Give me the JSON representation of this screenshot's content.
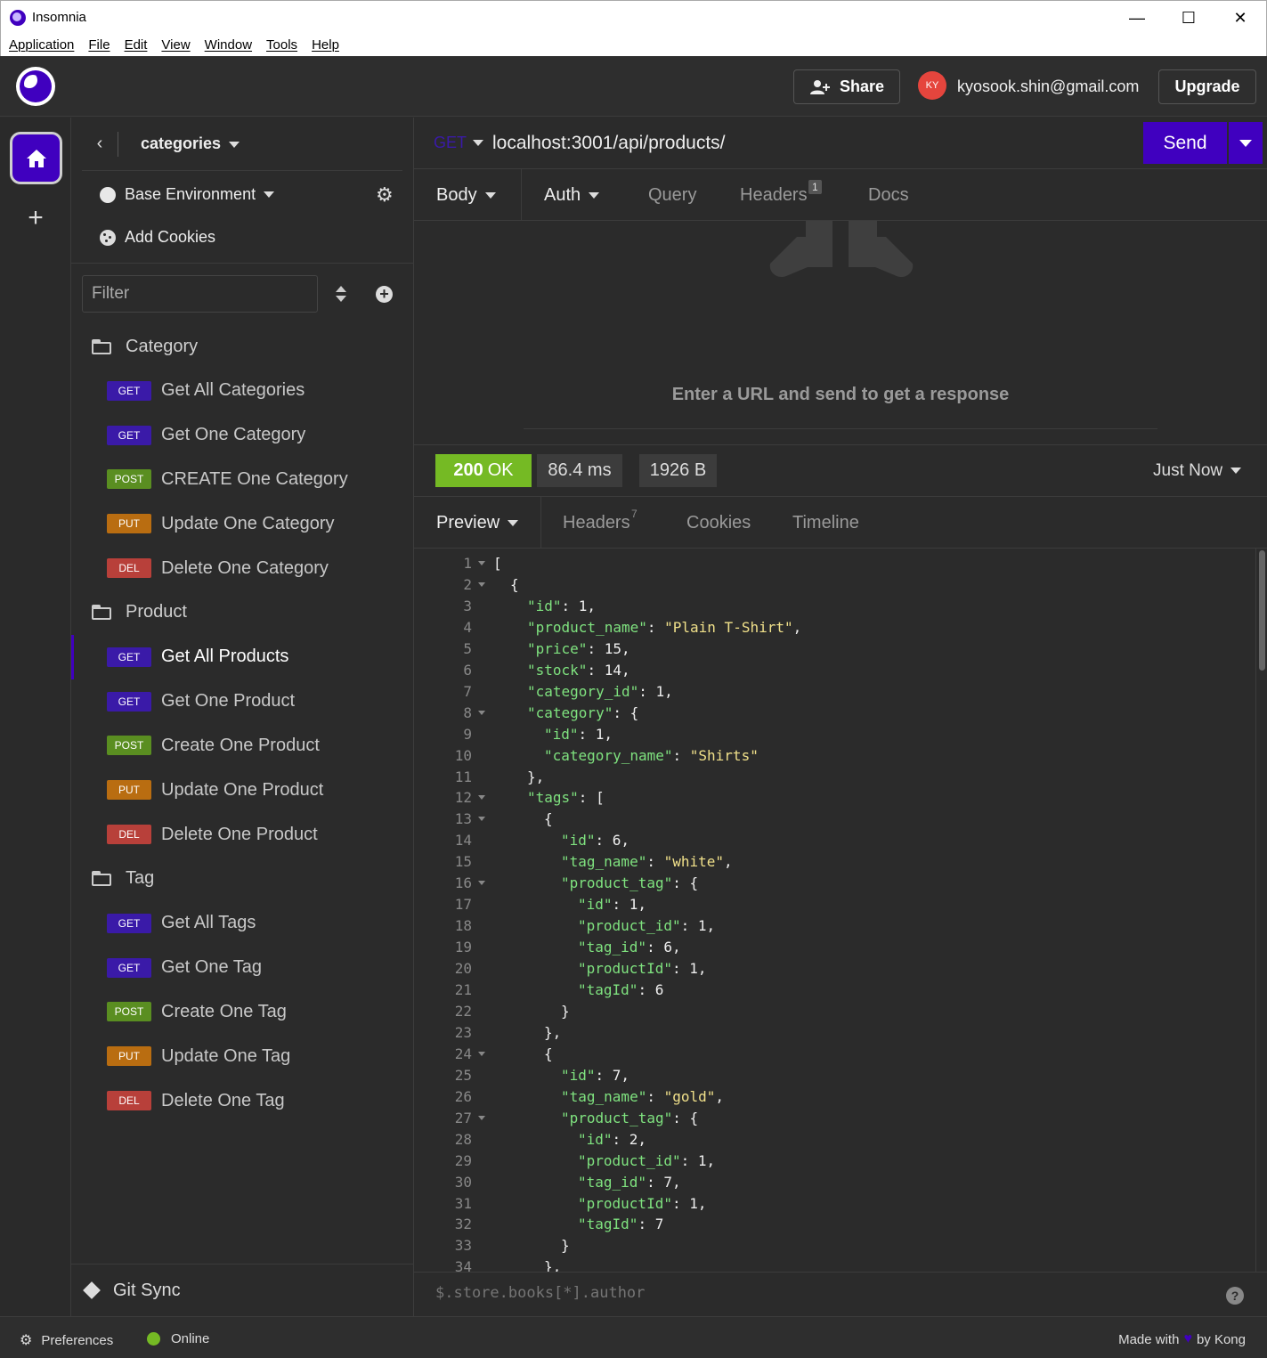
{
  "window": {
    "title": "Insomnia",
    "controls": {
      "minimize": "—",
      "maximize": "☐",
      "close": "✕"
    }
  },
  "menu": [
    "Application",
    "File",
    "Edit",
    "View",
    "Window",
    "Tools",
    "Help"
  ],
  "header": {
    "share_label": "Share",
    "avatar_initials": "KY",
    "user_email": "kyosook.shin@gmail.com",
    "upgrade_label": "Upgrade"
  },
  "sidebar": {
    "workspace": "categories",
    "environment": "Base Environment",
    "cookies_label": "Add Cookies",
    "filter_placeholder": "Filter",
    "groups": [
      {
        "name": "Category",
        "items": [
          {
            "method": "GET",
            "label": "Get All Categories"
          },
          {
            "method": "GET",
            "label": "Get One Category"
          },
          {
            "method": "POST",
            "label": "CREATE One Category"
          },
          {
            "method": "PUT",
            "label": "Update One Category"
          },
          {
            "method": "DEL",
            "label": "Delete One Category"
          }
        ]
      },
      {
        "name": "Product",
        "items": [
          {
            "method": "GET",
            "label": "Get All Products",
            "active": true
          },
          {
            "method": "GET",
            "label": "Get One Product"
          },
          {
            "method": "POST",
            "label": "Create One Product"
          },
          {
            "method": "PUT",
            "label": "Update One Product"
          },
          {
            "method": "DEL",
            "label": "Delete One Product"
          }
        ]
      },
      {
        "name": "Tag",
        "items": [
          {
            "method": "GET",
            "label": "Get All Tags"
          },
          {
            "method": "GET",
            "label": "Get One Tag"
          },
          {
            "method": "POST",
            "label": "Create One Tag"
          },
          {
            "method": "PUT",
            "label": "Update One Tag"
          },
          {
            "method": "DEL",
            "label": "Delete One Tag"
          }
        ]
      }
    ],
    "git_sync_label": "Git Sync"
  },
  "request": {
    "method": "GET",
    "url": "localhost:3001/api/products/",
    "send_label": "Send",
    "tabs": {
      "body": "Body",
      "auth": "Auth",
      "query": "Query",
      "headers": "Headers",
      "headers_count": "1",
      "docs": "Docs"
    },
    "empty_message": "Enter a URL and send to get a response"
  },
  "response": {
    "status_code": "200",
    "status_text": "OK",
    "time": "86.4 ms",
    "size": "1926 B",
    "when": "Just Now",
    "tabs": {
      "preview": "Preview",
      "headers": "Headers",
      "headers_count": "7",
      "cookies": "Cookies",
      "timeline": "Timeline"
    },
    "filter_placeholder": "$.store.books[*].author"
  },
  "code_lines": [
    {
      "n": "1",
      "fold": true,
      "indent": 0,
      "text": "["
    },
    {
      "n": "2",
      "fold": true,
      "indent": 1,
      "text": "{"
    },
    {
      "n": "3",
      "indent": 2,
      "key": "\"id\"",
      "rest": ": 1,"
    },
    {
      "n": "4",
      "indent": 2,
      "key": "\"product_name\"",
      "rest": ": ",
      "str": "\"Plain T-Shirt\"",
      "tail": ","
    },
    {
      "n": "5",
      "indent": 2,
      "key": "\"price\"",
      "rest": ": 15,"
    },
    {
      "n": "6",
      "indent": 2,
      "key": "\"stock\"",
      "rest": ": 14,"
    },
    {
      "n": "7",
      "indent": 2,
      "key": "\"category_id\"",
      "rest": ": 1,"
    },
    {
      "n": "8",
      "fold": true,
      "indent": 2,
      "key": "\"category\"",
      "rest": ": {"
    },
    {
      "n": "9",
      "indent": 3,
      "key": "\"id\"",
      "rest": ": 1,"
    },
    {
      "n": "10",
      "indent": 3,
      "key": "\"category_name\"",
      "rest": ": ",
      "str": "\"Shirts\"",
      "tail": ""
    },
    {
      "n": "11",
      "indent": 2,
      "text": "},"
    },
    {
      "n": "12",
      "fold": true,
      "indent": 2,
      "key": "\"tags\"",
      "rest": ": ["
    },
    {
      "n": "13",
      "fold": true,
      "indent": 3,
      "text": "{"
    },
    {
      "n": "14",
      "indent": 4,
      "key": "\"id\"",
      "rest": ": 6,"
    },
    {
      "n": "15",
      "indent": 4,
      "key": "\"tag_name\"",
      "rest": ": ",
      "str": "\"white\"",
      "tail": ","
    },
    {
      "n": "16",
      "fold": true,
      "indent": 4,
      "key": "\"product_tag\"",
      "rest": ": {"
    },
    {
      "n": "17",
      "indent": 5,
      "key": "\"id\"",
      "rest": ": 1,"
    },
    {
      "n": "18",
      "indent": 5,
      "key": "\"product_id\"",
      "rest": ": 1,"
    },
    {
      "n": "19",
      "indent": 5,
      "key": "\"tag_id\"",
      "rest": ": 6,"
    },
    {
      "n": "20",
      "indent": 5,
      "key": "\"productId\"",
      "rest": ": 1,"
    },
    {
      "n": "21",
      "indent": 5,
      "key": "\"tagId\"",
      "rest": ": 6"
    },
    {
      "n": "22",
      "indent": 4,
      "text": "}"
    },
    {
      "n": "23",
      "indent": 3,
      "text": "},"
    },
    {
      "n": "24",
      "fold": true,
      "indent": 3,
      "text": "{"
    },
    {
      "n": "25",
      "indent": 4,
      "key": "\"id\"",
      "rest": ": 7,"
    },
    {
      "n": "26",
      "indent": 4,
      "key": "\"tag_name\"",
      "rest": ": ",
      "str": "\"gold\"",
      "tail": ","
    },
    {
      "n": "27",
      "fold": true,
      "indent": 4,
      "key": "\"product_tag\"",
      "rest": ": {"
    },
    {
      "n": "28",
      "indent": 5,
      "key": "\"id\"",
      "rest": ": 2,"
    },
    {
      "n": "29",
      "indent": 5,
      "key": "\"product_id\"",
      "rest": ": 1,"
    },
    {
      "n": "30",
      "indent": 5,
      "key": "\"tag_id\"",
      "rest": ": 7,"
    },
    {
      "n": "31",
      "indent": 5,
      "key": "\"productId\"",
      "rest": ": 1,"
    },
    {
      "n": "32",
      "indent": 5,
      "key": "\"tagId\"",
      "rest": ": 7"
    },
    {
      "n": "33",
      "indent": 4,
      "text": "}"
    },
    {
      "n": "34",
      "indent": 3,
      "text": "},"
    }
  ],
  "statusbar": {
    "preferences": "Preferences",
    "online": "Online",
    "made_with": "Made with",
    "by": "by Kong"
  },
  "colors": {
    "accent": "#4000bf",
    "get": "#3a1aa8",
    "post": "#5a8e21",
    "put": "#b96d11",
    "del": "#b8403a",
    "ok": "#75ba24"
  }
}
